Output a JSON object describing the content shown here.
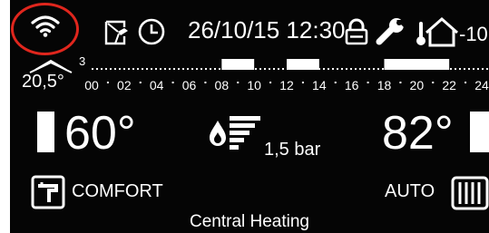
{
  "status": {
    "datetime": "26/10/15 12:30",
    "outdoor_temp": "-10",
    "icons": [
      "wifi-icon",
      "manual-mode-icon",
      "clock-icon",
      "lock-icon",
      "wrench-icon",
      "outdoor-temperature-icon"
    ],
    "highlight_color": "#e0261d"
  },
  "timeline": {
    "room_temp": "20,5°",
    "room_temp_sup": "3",
    "hours": [
      "00",
      "02",
      "04",
      "06",
      "08",
      "10",
      "12",
      "14",
      "16",
      "18",
      "20",
      "22",
      "24"
    ],
    "active_slots": [
      [
        8,
        10
      ],
      [
        12,
        14
      ],
      [
        18,
        22
      ]
    ]
  },
  "readouts": {
    "dhw_temp": "60°",
    "pressure": "1,5 bar",
    "ch_temp": "82°"
  },
  "modes": {
    "dhw_mode": "COMFORT",
    "ch_mode": "AUTO",
    "function_label": "Central Heating"
  },
  "colors": {
    "background": "#050505",
    "foreground": "#ffffff"
  }
}
